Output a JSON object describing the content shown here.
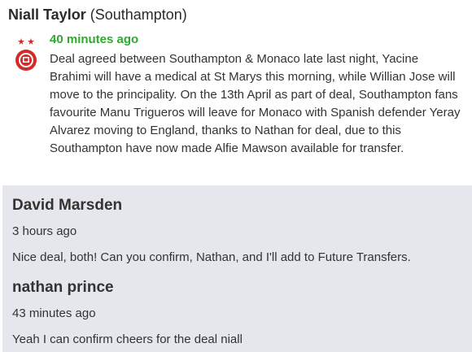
{
  "post": {
    "author": "Niall Taylor",
    "team": "(Southampton)",
    "time": "40 minutes ago",
    "text": "Deal agreed between Southampton & Monaco late last night, Yacine Brahimi will have a medical at St Marys this morning, while Willian Jose will move to the principality. On the 13th April as part of deal, Southampton fans favourite Manu Trigueros will leave for Monaco with Spanish defender Yeray Alvarez moving to England, thanks to Nathan for deal, due to this Southampton have now made Alfie Mawson available for transfer.",
    "avatar_icon": "club-crest-icon",
    "time_color": "#2eaa2e"
  },
  "comments": [
    {
      "name": "David Marsden",
      "time": "3 hours ago",
      "text": "Nice deal, both! Can you confirm, Nathan, and I'll add to Future Transfers."
    },
    {
      "name": "nathan prince",
      "time": "43 minutes ago",
      "text": "Yeah I can confirm cheers for the deal niall"
    }
  ],
  "colors": {
    "comments_background": "#e6e7ec",
    "crest_red": "#d42a2a"
  }
}
